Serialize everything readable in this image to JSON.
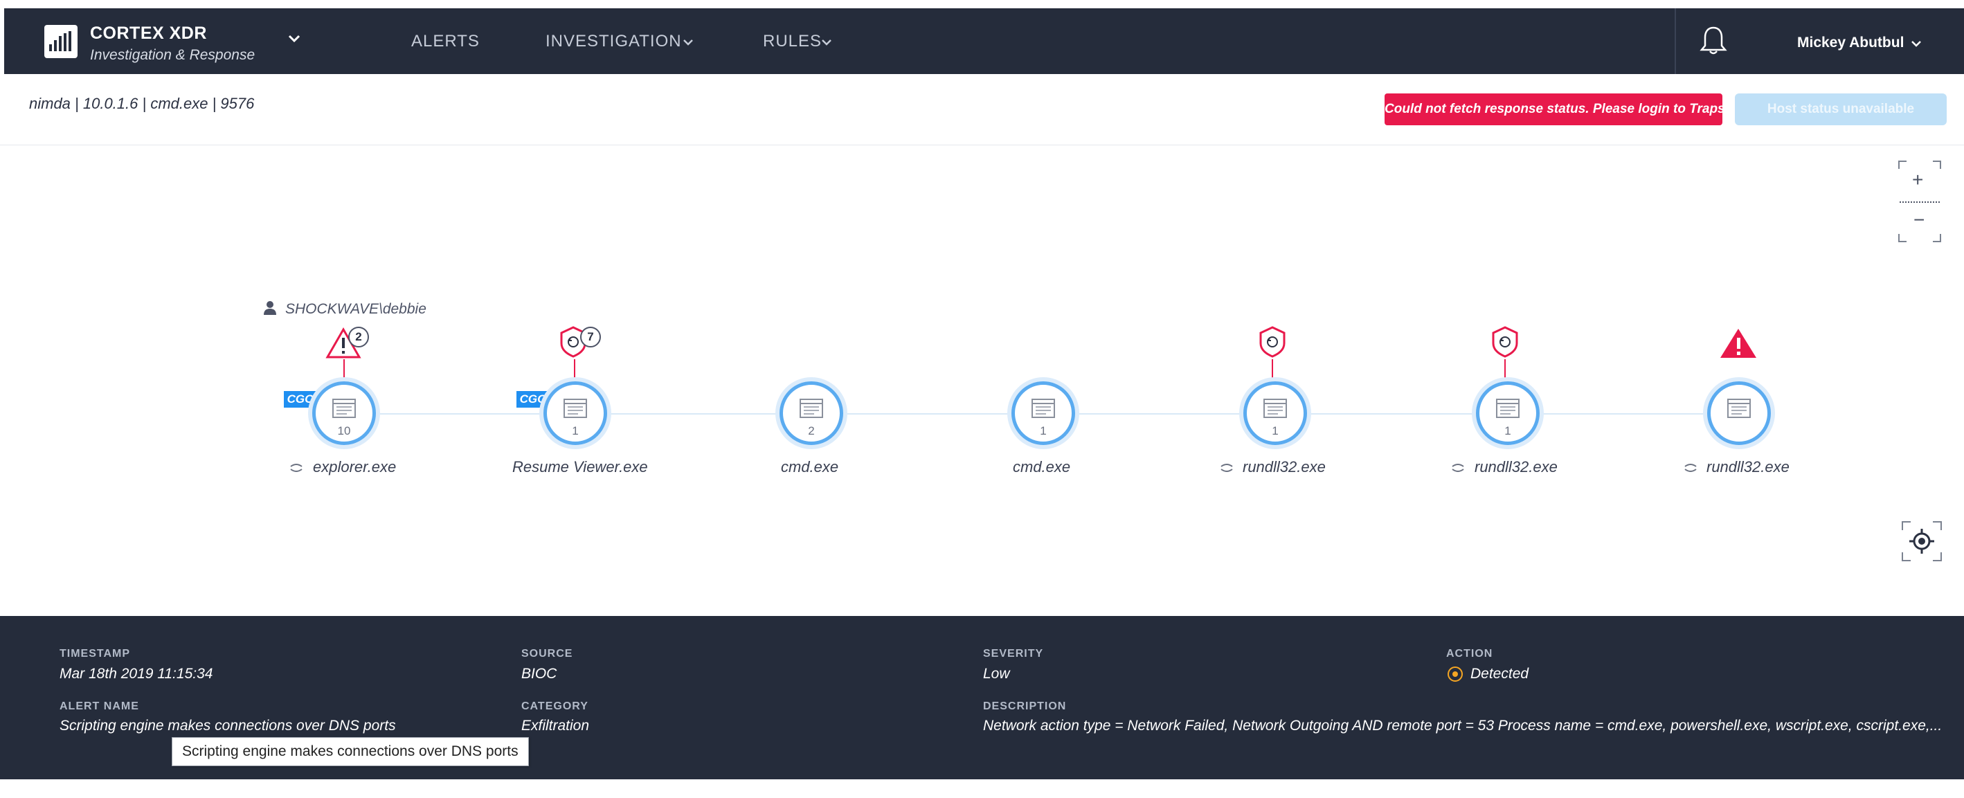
{
  "brand": {
    "title": "CORTEX XDR",
    "subtitle": "Investigation & Response"
  },
  "nav": {
    "alerts": "ALERTS",
    "investigation": "INVESTIGATION",
    "rules": "RULES"
  },
  "user": {
    "name": "Mickey Abutbul"
  },
  "context": {
    "breadcrumb": "nimda | 10.0.1.6 | cmd.exe | 9576"
  },
  "status": {
    "error_message": "Could not fetch response status. Please login to Traps",
    "host_status": "Host status unavailable"
  },
  "zoom": {
    "plus": "+",
    "minus": "−"
  },
  "graph": {
    "user_account": "SHOCKWAVE\\debbie",
    "nodes": [
      {
        "label": "explorer.exe",
        "count": "10",
        "cgo": "CGO",
        "alert": "warning",
        "alert_count": "2"
      },
      {
        "label": "Resume Viewer.exe",
        "count": "1",
        "cgo": "CGO",
        "alert": "shield",
        "alert_count": "7"
      },
      {
        "label": "cmd.exe",
        "count": "2"
      },
      {
        "label": "cmd.exe",
        "count": "1"
      },
      {
        "label": "rundll32.exe",
        "count": "1",
        "alert": "shield"
      },
      {
        "label": "rundll32.exe",
        "count": "1",
        "alert": "shield"
      },
      {
        "label": "rundll32.exe",
        "count": "",
        "alert": "warning-filled"
      }
    ]
  },
  "details": {
    "timestamp_label": "TIMESTAMP",
    "timestamp": "Mar 18th 2019 11:15:34",
    "source_label": "SOURCE",
    "source": "BIOC",
    "severity_label": "SEVERITY",
    "severity": "Low",
    "action_label": "ACTION",
    "action": "Detected",
    "alert_name_label": "ALERT NAME",
    "alert_name": "Scripting engine makes connections over DNS ports",
    "category_label": "CATEGORY",
    "category": "Exfiltration",
    "description_label": "DESCRIPTION",
    "description": "Network action type = Network Failed, Network Outgoing AND remote port = 53 Process name = cmd.exe, powershell.exe, wscript.exe, cscript.exe,..."
  },
  "tooltip": {
    "text": "Scripting engine makes connections over DNS ports"
  },
  "colors": {
    "nav_bg": "#252c3b",
    "accent_blue": "#5aabf0",
    "cgo_blue": "#1f8ff1",
    "alert_red": "#e8194b",
    "host_status_bg": "#bfe0f7",
    "action_orange": "#f5a623"
  }
}
